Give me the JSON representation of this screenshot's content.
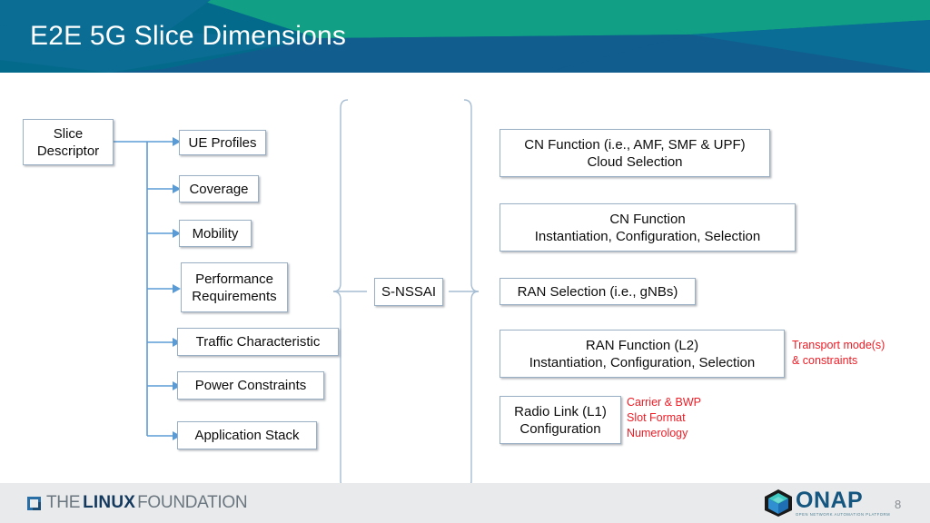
{
  "slide": {
    "title": "E2E 5G Slice Dimensions",
    "page_number": "8",
    "banner_colors": {
      "base_blue": "#046a8c",
      "teal": "#11a085",
      "dark_blue": "#115d8e",
      "mid_blue": "#0a6f95"
    },
    "accent_red": "#ee1c25"
  },
  "diagram": {
    "root": {
      "label": "Slice\nDescriptor"
    },
    "descriptor_items": [
      {
        "label": "UE Profiles"
      },
      {
        "label": "Coverage"
      },
      {
        "label": "Mobility"
      },
      {
        "label": "Performance\nRequirements"
      },
      {
        "label": "Traffic Characteristic"
      },
      {
        "label": "Power Constraints"
      },
      {
        "label": "Application Stack"
      }
    ],
    "center": {
      "label": "S-NSSAI"
    },
    "outputs": [
      {
        "label": "CN Function (i.e., AMF, SMF & UPF)\nCloud Selection"
      },
      {
        "label": "CN Function\nInstantiation, Configuration, Selection"
      },
      {
        "label": "RAN Selection (i.e., gNBs)"
      },
      {
        "label": "RAN Function (L2)\nInstantiation, Configuration, Selection"
      },
      {
        "label": "Radio Link (L1)\nConfiguration"
      }
    ],
    "annotations": [
      {
        "label": "Transport mode(s)\n& constraints"
      },
      {
        "label": "Carrier & BWP\nSlot Format\nNumerology"
      }
    ]
  },
  "footer": {
    "linux_foundation": {
      "the": "THE",
      "linux": "LINUX",
      "foundation": "FOUNDATION"
    },
    "onap": {
      "word": "ONAP",
      "tagline": "OPEN NETWORK AUTOMATION PLATFORM"
    }
  }
}
